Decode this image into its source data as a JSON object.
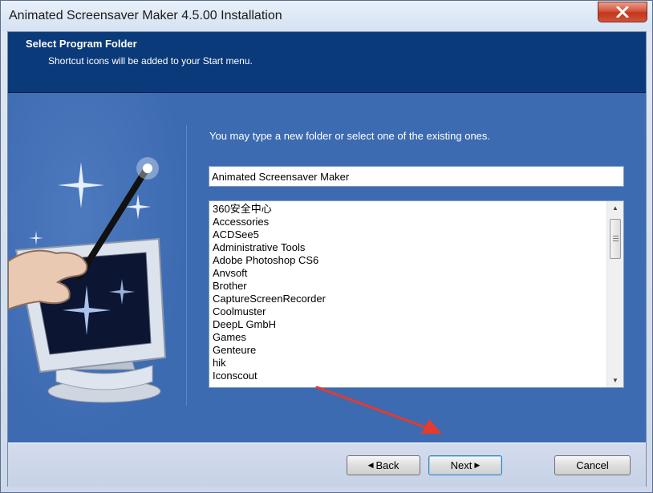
{
  "window": {
    "title": "Animated Screensaver Maker 4.5.00 Installation"
  },
  "header": {
    "title": "Select Program Folder",
    "subtitle": "Shortcut icons will be added to your Start menu."
  },
  "main": {
    "instruction": "You may type a new folder or select one of the existing ones.",
    "folder_value": "Animated Screensaver Maker",
    "folders": [
      "360安全中心",
      "Accessories",
      "ACDSee5",
      "Administrative Tools",
      "Adobe Photoshop CS6",
      "Anvsoft",
      "Brother",
      "CaptureScreenRecorder",
      "Coolmuster",
      "DeepL GmbH",
      "Games",
      "Genteure",
      "hik",
      "Iconscout"
    ]
  },
  "buttons": {
    "back": "Back",
    "next": "Next",
    "cancel": "Cancel"
  },
  "colors": {
    "header_bg": "#0a3a7a",
    "main_bg": "#3d6bb2",
    "annotation_arrow": "#e53b2c"
  }
}
